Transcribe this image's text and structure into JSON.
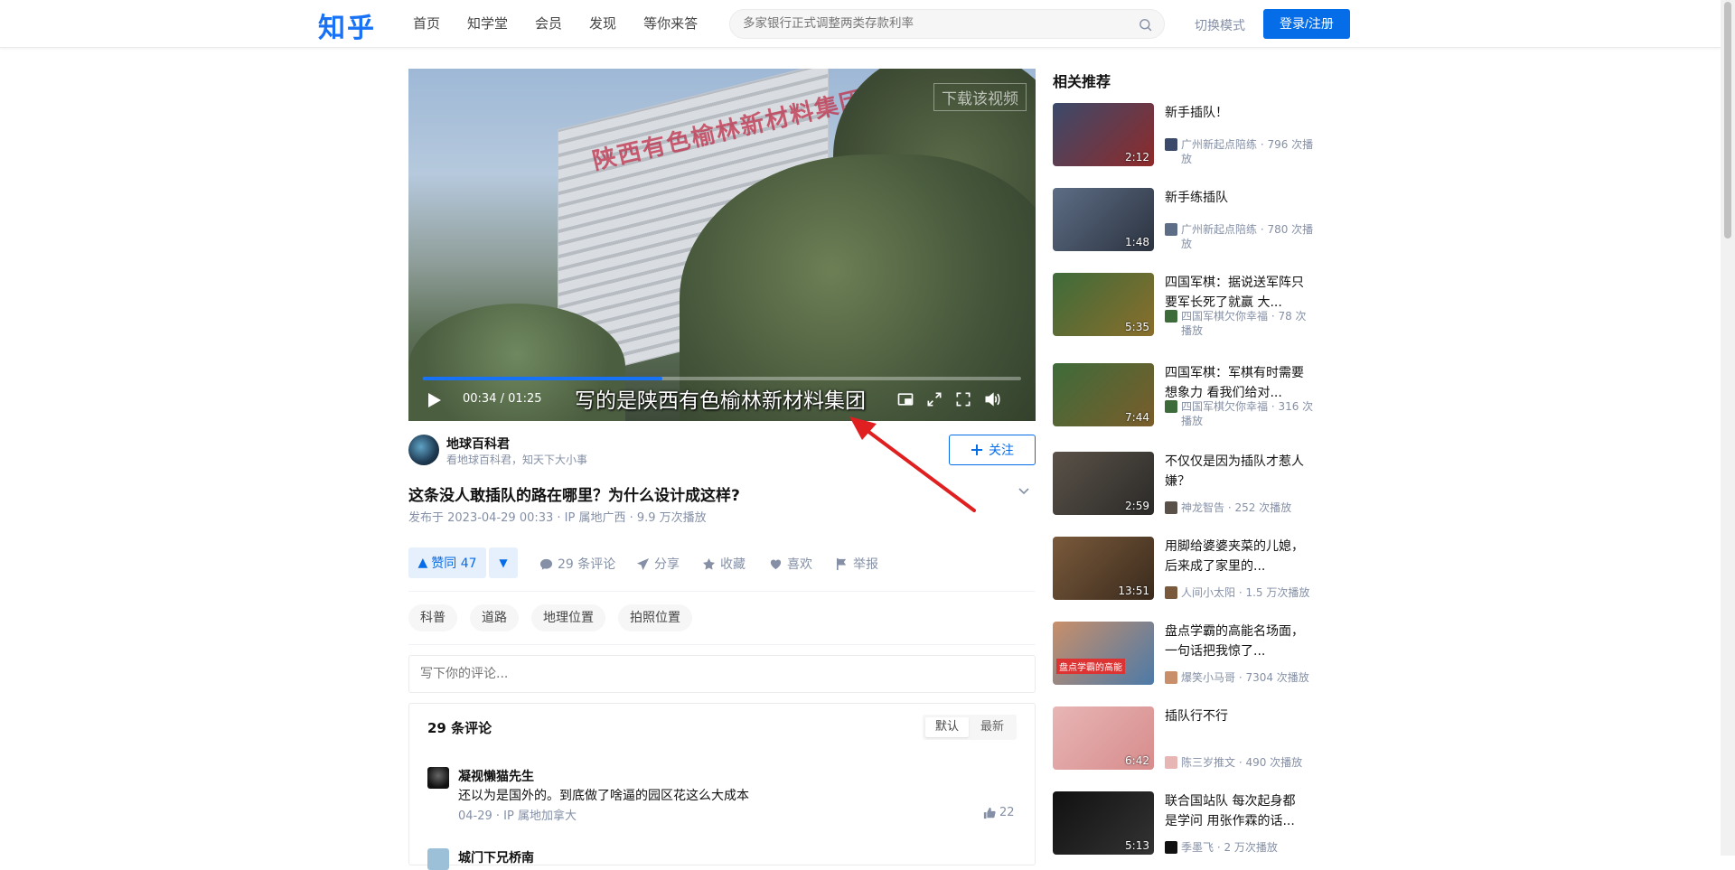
{
  "header": {
    "logo": "知乎",
    "nav": [
      "首页",
      "知学堂",
      "会员",
      "发现",
      "等你来答"
    ],
    "search_placeholder": "多家银行正式调整两类存款利率",
    "mode_switch": "切换模式",
    "login": "登录/注册"
  },
  "video": {
    "watermark": "下载该视频",
    "sign_text": "陕西有色榆林新材料集团",
    "time": "00:34 / 01:25",
    "progress": 0.4,
    "subtitle": "写的是陕西有色榆林新材料集团"
  },
  "author": {
    "name": "地球百科君",
    "bio": "看地球百科君，知天下大小事",
    "follow": "关注"
  },
  "post": {
    "title": "这条没人敢插队的路在哪里？为什么设计成这样?",
    "meta": "发布于 2023-04-29 00:33 · IP 属地广西 · 9.9 万次播放"
  },
  "actions": {
    "upvote": "赞同 47",
    "comments": "29 条评论",
    "share": "分享",
    "collect": "收藏",
    "like": "喜欢",
    "report": "举报"
  },
  "tags": [
    "科普",
    "道路",
    "地理位置",
    "拍照位置"
  ],
  "comment_box": {
    "placeholder": "写下你的评论...",
    "count": "29 条评论",
    "sort_default": "默认",
    "sort_latest": "最新",
    "items": [
      {
        "name": "凝视懒猫先生",
        "text": "还以为是国外的。到底做了啥逼的园区花这么大成本",
        "meta": "04-29 · IP 属地加拿大",
        "likes": "22"
      },
      {
        "name": "城门下兄桥南"
      }
    ]
  },
  "sidebar": {
    "title": "相关推荐",
    "items": [
      {
        "title": "新手插队！",
        "duration": "2:12",
        "meta": "广州新起点陪练 · 796 次播放",
        "colors": [
          "#3b4a6b",
          "#8f2a2a"
        ]
      },
      {
        "title": "新手练插队",
        "duration": "1:48",
        "meta": "广州新起点陪练 · 780 次播放",
        "colors": [
          "#5d6d85",
          "#2c3340"
        ]
      },
      {
        "title": "四国军棋：据说送军阵只要军长死了就赢 大...",
        "duration": "5:35",
        "meta": "四国军棋欠你幸福 · 78 次播放",
        "colors": [
          "#3e6b3a",
          "#8a6e2b"
        ]
      },
      {
        "title": "四国军棋：军棋有时需要想象力 看我们给对...",
        "duration": "7:44",
        "meta": "四国军棋欠你幸福 · 316 次播放",
        "colors": [
          "#3e6b3a",
          "#7a5d2b"
        ]
      },
      {
        "title": "不仅仅是因为插队才惹人嫌？",
        "duration": "2:59",
        "meta": "神龙智告 · 252 次播放",
        "colors": [
          "#5a5248",
          "#2b2a28"
        ]
      },
      {
        "title": "用脚给婆婆夹菜的儿媳，后来成了家里的...",
        "duration": "13:51",
        "meta": "人间小太阳 · 1.5 万次播放",
        "colors": [
          "#7a5a3c",
          "#3a2a1c"
        ]
      },
      {
        "title": "盘点学霸的高能名场面，一句话把我惊了...",
        "duration": "",
        "meta": "爆笑小马哥 · 7304 次播放",
        "overlay": "盘点学霸的高能",
        "colors": [
          "#c98f6a",
          "#4c7aa8"
        ]
      },
      {
        "title": "插队行不行",
        "duration": "6:42",
        "meta": "陈三岁推文 · 490 次播放",
        "colors": [
          "#e8b5b5",
          "#d78c8c"
        ]
      },
      {
        "title": "联合国站队 每次起身都是学问 用张作霖的话...",
        "duration": "5:13",
        "meta": "季墨飞 · 2 万次播放",
        "colors": [
          "#111111",
          "#333333"
        ]
      }
    ]
  }
}
